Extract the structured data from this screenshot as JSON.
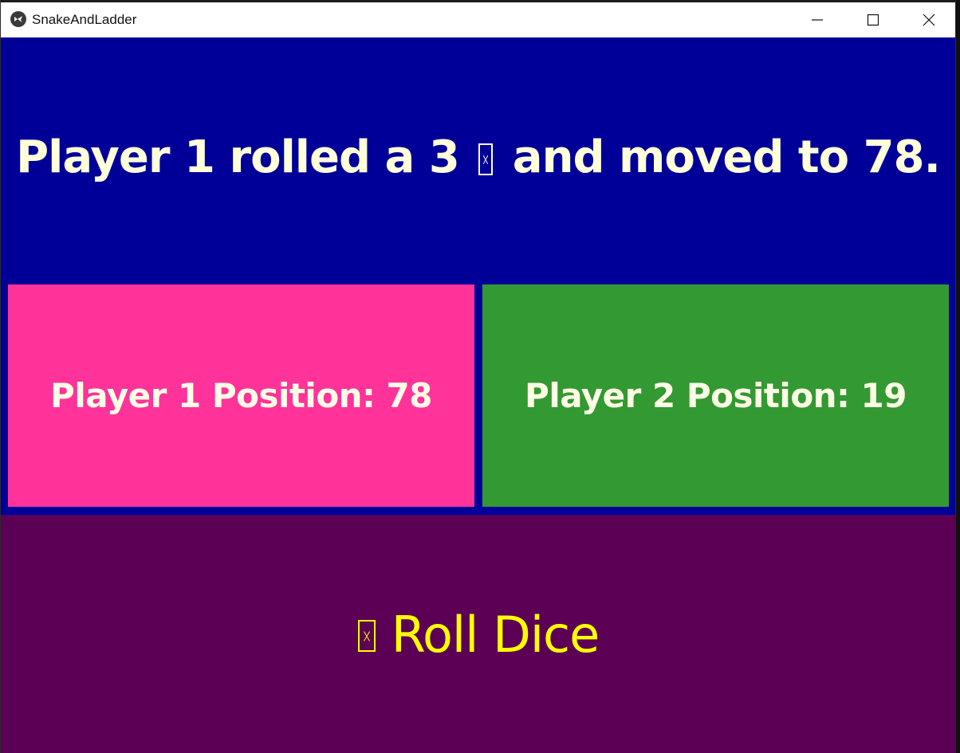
{
  "window": {
    "title": "SnakeAndLadder",
    "app_icon": "kivy-logo-icon",
    "controls": {
      "minimize_icon": "minimize-icon",
      "maximize_icon": "maximize-icon",
      "close_icon": "close-icon"
    }
  },
  "status": {
    "message_before": "Player 1 rolled a 3",
    "glyph": "missing-glyph-box",
    "message_after": "and moved to 78."
  },
  "players": [
    {
      "label": "Player 1 Position: 78",
      "color": "#ff3399"
    },
    {
      "label": "Player 2 Position: 19",
      "color": "#339933"
    }
  ],
  "roll_button": {
    "icon": "missing-glyph-box",
    "label": "Roll Dice",
    "text_color": "#ffff00",
    "background": "#5c0055"
  },
  "colors": {
    "background": "#000099",
    "status_text": "#ffffd9"
  }
}
